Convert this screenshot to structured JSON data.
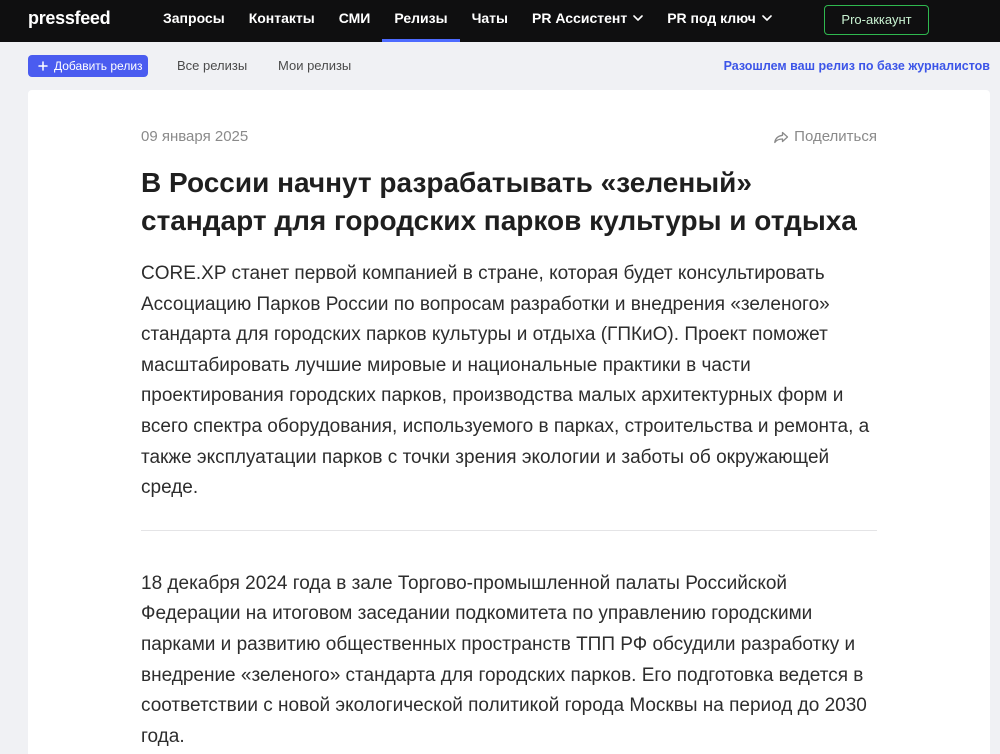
{
  "header": {
    "logo": "pressfeed",
    "nav": [
      {
        "label": "Запросы",
        "active": false
      },
      {
        "label": "Контакты",
        "active": false
      },
      {
        "label": "СМИ",
        "active": false
      },
      {
        "label": "Релизы",
        "active": true
      },
      {
        "label": "Чаты",
        "active": false
      },
      {
        "label": "PR Ассистент",
        "active": false,
        "icon": "chevron-down-icon"
      },
      {
        "label": "PR под ключ",
        "active": false,
        "icon": "chevron-down-icon"
      }
    ],
    "pro_button": "Pro-аккаунт"
  },
  "subnav": {
    "add_button": {
      "label": "Добавить релиз",
      "icon": "plus-icon"
    },
    "tabs": [
      {
        "label": "Все релизы"
      },
      {
        "label": "Мои релизы"
      }
    ],
    "promo_link": "Разошлем ваш релиз по базе журналистов"
  },
  "release": {
    "date": "09 января 2025",
    "share": {
      "label": "Поделиться",
      "icon": "share-icon"
    },
    "title": "В России начнут разрабатывать «зеленый» стандарт для городских парков культуры и отдыха",
    "lead": "CORE.XP станет первой компанией в стране, которая будет консультировать Ассоциацию Парков России по вопросам разработки и внедрения «зеленого» стандарта для городских парков культуры и отдыха (ГПКиО). Проект поможет масштабировать лучшие мировые и национальные практики в части проектирования городских парков, производства малых архитектурных форм и всего спектра оборудования, используемого в парках, строительства и ремонта, а также эксплуатации парков с точки зрения экологии и заботы об окружающей среде.",
    "body": [
      "18 декабря 2024 года в зале Торгово-промышленной палаты Российской Федерации на итоговом заседании подкомитета по управлению городскими парками и развитию общественных пространств ТПП РФ обсудили разработку и внедрение «зеленого» стандарта для городских парков. Его подготовка ведется в соответствии с новой экологической политикой города Москвы на период до 2030 года."
    ]
  },
  "colors": {
    "nav_bg": "#0f0f10",
    "accent": "#4a5cf0",
    "active_underline": "#4d6bff",
    "pro_green": "#2fb84f",
    "pro_text": "#c9f2d1",
    "link": "#3c55e8",
    "page_bg": "#f0f1f4"
  }
}
